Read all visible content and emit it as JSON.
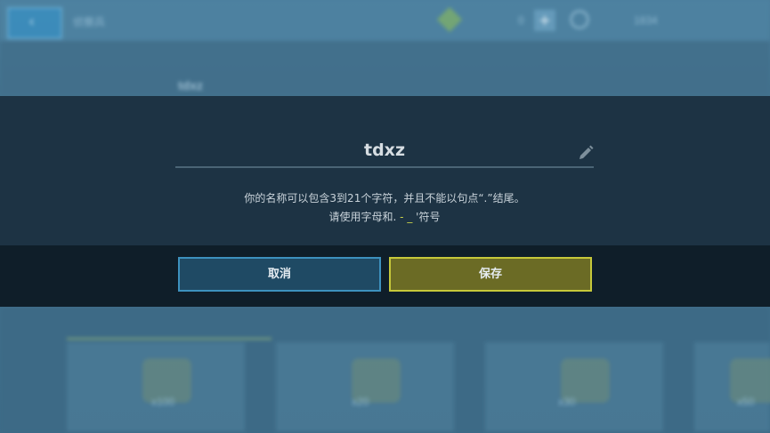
{
  "background": {
    "top_left_label": "侦察兵",
    "header_counter": "0",
    "top_right_label": "1834",
    "player_name": "tdxz",
    "cards": [
      {
        "label": "x100"
      },
      {
        "label": "x20"
      },
      {
        "label": "x30"
      },
      {
        "label": "x50"
      }
    ]
  },
  "dialog": {
    "name_value": "tdxz",
    "hint_line1": "你的名称可以包含3到21个字符，并且不能以句点“.”结尾。",
    "hint_line2_prefix": "请使用字母和.",
    "hint_line2_symbols": " - _ ",
    "hint_line2_suffix": "'符号",
    "cancel_label": "取消",
    "save_label": "保存"
  },
  "colors": {
    "dialog_bg": "#1d3344",
    "cancel_border": "#3d91bd",
    "save_border": "#c6c83a",
    "save_bg": "#6b6b25",
    "symbol_accent": "#c8d24a"
  }
}
